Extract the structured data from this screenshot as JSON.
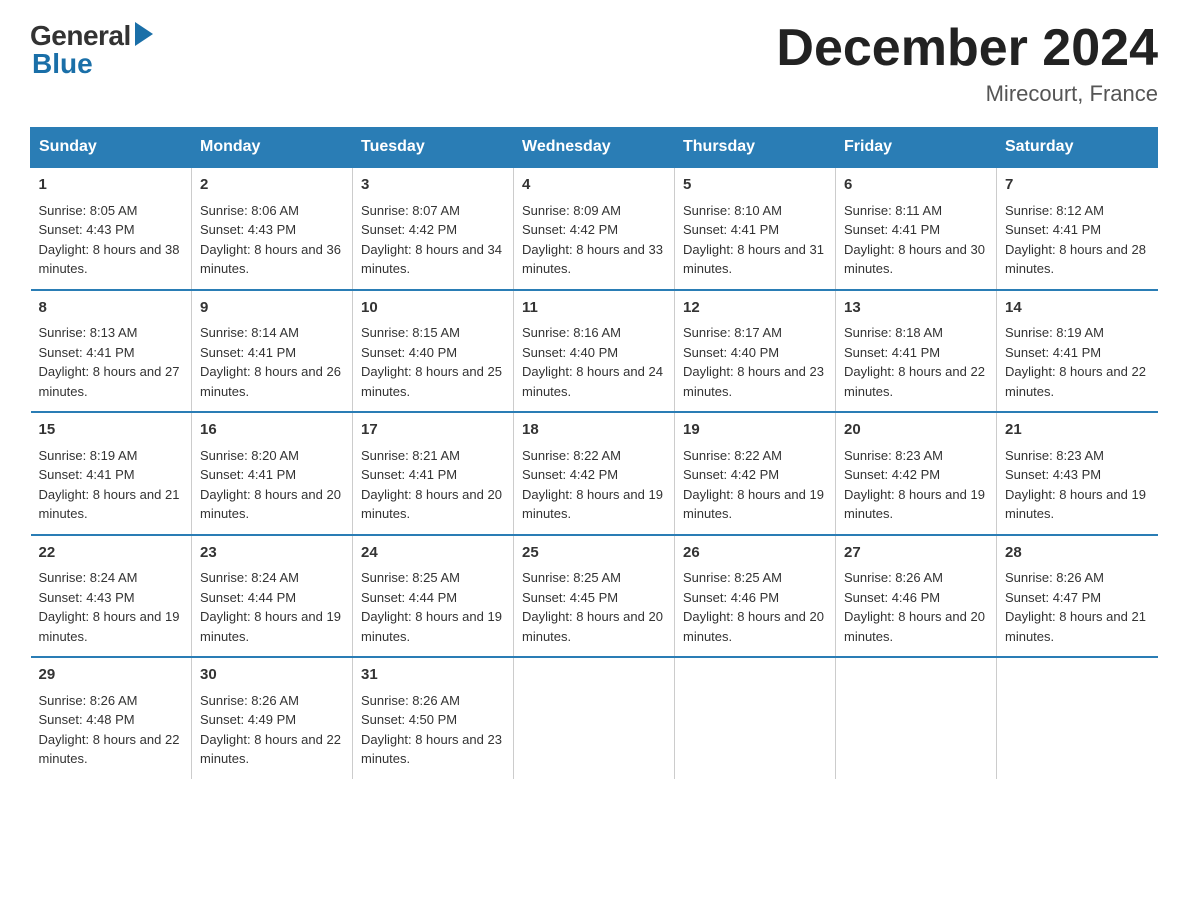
{
  "header": {
    "title": "December 2024",
    "location": "Mirecourt, France",
    "logo_general": "General",
    "logo_blue": "Blue"
  },
  "days_of_week": [
    "Sunday",
    "Monday",
    "Tuesday",
    "Wednesday",
    "Thursday",
    "Friday",
    "Saturday"
  ],
  "weeks": [
    [
      {
        "day": "1",
        "sunrise": "8:05 AM",
        "sunset": "4:43 PM",
        "daylight": "8 hours and 38 minutes."
      },
      {
        "day": "2",
        "sunrise": "8:06 AM",
        "sunset": "4:43 PM",
        "daylight": "8 hours and 36 minutes."
      },
      {
        "day": "3",
        "sunrise": "8:07 AM",
        "sunset": "4:42 PM",
        "daylight": "8 hours and 34 minutes."
      },
      {
        "day": "4",
        "sunrise": "8:09 AM",
        "sunset": "4:42 PM",
        "daylight": "8 hours and 33 minutes."
      },
      {
        "day": "5",
        "sunrise": "8:10 AM",
        "sunset": "4:41 PM",
        "daylight": "8 hours and 31 minutes."
      },
      {
        "day": "6",
        "sunrise": "8:11 AM",
        "sunset": "4:41 PM",
        "daylight": "8 hours and 30 minutes."
      },
      {
        "day": "7",
        "sunrise": "8:12 AM",
        "sunset": "4:41 PM",
        "daylight": "8 hours and 28 minutes."
      }
    ],
    [
      {
        "day": "8",
        "sunrise": "8:13 AM",
        "sunset": "4:41 PM",
        "daylight": "8 hours and 27 minutes."
      },
      {
        "day": "9",
        "sunrise": "8:14 AM",
        "sunset": "4:41 PM",
        "daylight": "8 hours and 26 minutes."
      },
      {
        "day": "10",
        "sunrise": "8:15 AM",
        "sunset": "4:40 PM",
        "daylight": "8 hours and 25 minutes."
      },
      {
        "day": "11",
        "sunrise": "8:16 AM",
        "sunset": "4:40 PM",
        "daylight": "8 hours and 24 minutes."
      },
      {
        "day": "12",
        "sunrise": "8:17 AM",
        "sunset": "4:40 PM",
        "daylight": "8 hours and 23 minutes."
      },
      {
        "day": "13",
        "sunrise": "8:18 AM",
        "sunset": "4:41 PM",
        "daylight": "8 hours and 22 minutes."
      },
      {
        "day": "14",
        "sunrise": "8:19 AM",
        "sunset": "4:41 PM",
        "daylight": "8 hours and 22 minutes."
      }
    ],
    [
      {
        "day": "15",
        "sunrise": "8:19 AM",
        "sunset": "4:41 PM",
        "daylight": "8 hours and 21 minutes."
      },
      {
        "day": "16",
        "sunrise": "8:20 AM",
        "sunset": "4:41 PM",
        "daylight": "8 hours and 20 minutes."
      },
      {
        "day": "17",
        "sunrise": "8:21 AM",
        "sunset": "4:41 PM",
        "daylight": "8 hours and 20 minutes."
      },
      {
        "day": "18",
        "sunrise": "8:22 AM",
        "sunset": "4:42 PM",
        "daylight": "8 hours and 19 minutes."
      },
      {
        "day": "19",
        "sunrise": "8:22 AM",
        "sunset": "4:42 PM",
        "daylight": "8 hours and 19 minutes."
      },
      {
        "day": "20",
        "sunrise": "8:23 AM",
        "sunset": "4:42 PM",
        "daylight": "8 hours and 19 minutes."
      },
      {
        "day": "21",
        "sunrise": "8:23 AM",
        "sunset": "4:43 PM",
        "daylight": "8 hours and 19 minutes."
      }
    ],
    [
      {
        "day": "22",
        "sunrise": "8:24 AM",
        "sunset": "4:43 PM",
        "daylight": "8 hours and 19 minutes."
      },
      {
        "day": "23",
        "sunrise": "8:24 AM",
        "sunset": "4:44 PM",
        "daylight": "8 hours and 19 minutes."
      },
      {
        "day": "24",
        "sunrise": "8:25 AM",
        "sunset": "4:44 PM",
        "daylight": "8 hours and 19 minutes."
      },
      {
        "day": "25",
        "sunrise": "8:25 AM",
        "sunset": "4:45 PM",
        "daylight": "8 hours and 20 minutes."
      },
      {
        "day": "26",
        "sunrise": "8:25 AM",
        "sunset": "4:46 PM",
        "daylight": "8 hours and 20 minutes."
      },
      {
        "day": "27",
        "sunrise": "8:26 AM",
        "sunset": "4:46 PM",
        "daylight": "8 hours and 20 minutes."
      },
      {
        "day": "28",
        "sunrise": "8:26 AM",
        "sunset": "4:47 PM",
        "daylight": "8 hours and 21 minutes."
      }
    ],
    [
      {
        "day": "29",
        "sunrise": "8:26 AM",
        "sunset": "4:48 PM",
        "daylight": "8 hours and 22 minutes."
      },
      {
        "day": "30",
        "sunrise": "8:26 AM",
        "sunset": "4:49 PM",
        "daylight": "8 hours and 22 minutes."
      },
      {
        "day": "31",
        "sunrise": "8:26 AM",
        "sunset": "4:50 PM",
        "daylight": "8 hours and 23 minutes."
      },
      null,
      null,
      null,
      null
    ]
  ]
}
